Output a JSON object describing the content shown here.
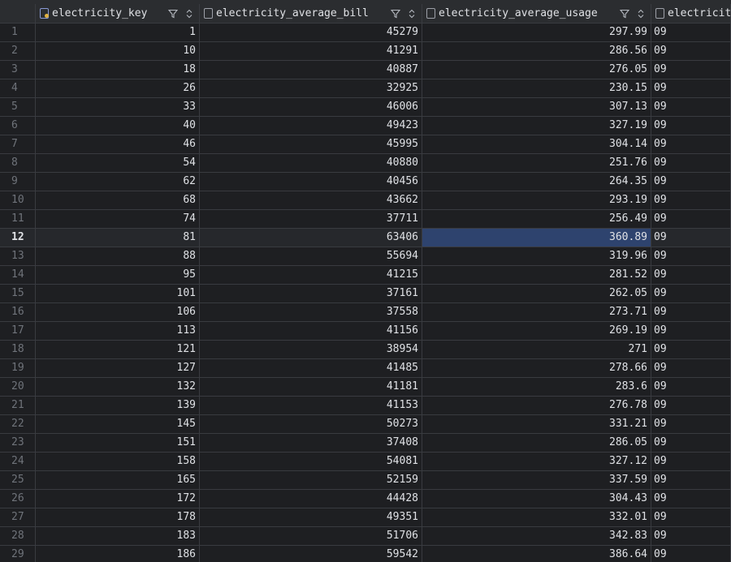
{
  "columns": [
    {
      "name": "electricity_key",
      "icon": "primary-key-column-icon"
    },
    {
      "name": "electricity_average_bill",
      "icon": "column-icon"
    },
    {
      "name": "electricity_average_usage",
      "icon": "column-icon"
    },
    {
      "name": "electricit",
      "icon": "column-icon"
    }
  ],
  "selected_row": 12,
  "selected_column": "electricity_average_usage",
  "rows": [
    {
      "n": "1",
      "key": "1",
      "bill": "45279",
      "usage": "297.99",
      "next": "09"
    },
    {
      "n": "2",
      "key": "10",
      "bill": "41291",
      "usage": "286.56",
      "next": "09"
    },
    {
      "n": "3",
      "key": "18",
      "bill": "40887",
      "usage": "276.05",
      "next": "09"
    },
    {
      "n": "4",
      "key": "26",
      "bill": "32925",
      "usage": "230.15",
      "next": "09"
    },
    {
      "n": "5",
      "key": "33",
      "bill": "46006",
      "usage": "307.13",
      "next": "09"
    },
    {
      "n": "6",
      "key": "40",
      "bill": "49423",
      "usage": "327.19",
      "next": "09"
    },
    {
      "n": "7",
      "key": "46",
      "bill": "45995",
      "usage": "304.14",
      "next": "09"
    },
    {
      "n": "8",
      "key": "54",
      "bill": "40880",
      "usage": "251.76",
      "next": "09"
    },
    {
      "n": "9",
      "key": "62",
      "bill": "40456",
      "usage": "264.35",
      "next": "09"
    },
    {
      "n": "10",
      "key": "68",
      "bill": "43662",
      "usage": "293.19",
      "next": "09"
    },
    {
      "n": "11",
      "key": "74",
      "bill": "37711",
      "usage": "256.49",
      "next": "09"
    },
    {
      "n": "12",
      "key": "81",
      "bill": "63406",
      "usage": "360.89",
      "next": "09"
    },
    {
      "n": "13",
      "key": "88",
      "bill": "55694",
      "usage": "319.96",
      "next": "09"
    },
    {
      "n": "14",
      "key": "95",
      "bill": "41215",
      "usage": "281.52",
      "next": "09"
    },
    {
      "n": "15",
      "key": "101",
      "bill": "37161",
      "usage": "262.05",
      "next": "09"
    },
    {
      "n": "16",
      "key": "106",
      "bill": "37558",
      "usage": "273.71",
      "next": "09"
    },
    {
      "n": "17",
      "key": "113",
      "bill": "41156",
      "usage": "269.19",
      "next": "09"
    },
    {
      "n": "18",
      "key": "121",
      "bill": "38954",
      "usage": "271",
      "next": "09"
    },
    {
      "n": "19",
      "key": "127",
      "bill": "41485",
      "usage": "278.66",
      "next": "09"
    },
    {
      "n": "20",
      "key": "132",
      "bill": "41181",
      "usage": "283.6",
      "next": "09"
    },
    {
      "n": "21",
      "key": "139",
      "bill": "41153",
      "usage": "276.78",
      "next": "09"
    },
    {
      "n": "22",
      "key": "145",
      "bill": "50273",
      "usage": "331.21",
      "next": "09"
    },
    {
      "n": "23",
      "key": "151",
      "bill": "37408",
      "usage": "286.05",
      "next": "09"
    },
    {
      "n": "24",
      "key": "158",
      "bill": "54081",
      "usage": "327.12",
      "next": "09"
    },
    {
      "n": "25",
      "key": "165",
      "bill": "52159",
      "usage": "337.59",
      "next": "09"
    },
    {
      "n": "26",
      "key": "172",
      "bill": "44428",
      "usage": "304.43",
      "next": "09"
    },
    {
      "n": "27",
      "key": "178",
      "bill": "49351",
      "usage": "332.01",
      "next": "09"
    },
    {
      "n": "28",
      "key": "183",
      "bill": "51706",
      "usage": "342.83",
      "next": "09"
    },
    {
      "n": "29",
      "key": "186",
      "bill": "59542",
      "usage": "386.64",
      "next": "09"
    }
  ],
  "colors": {
    "background": "#1e1f22",
    "header": "#2b2d30",
    "selection": "#2e436e",
    "current_row": "#26282c"
  }
}
